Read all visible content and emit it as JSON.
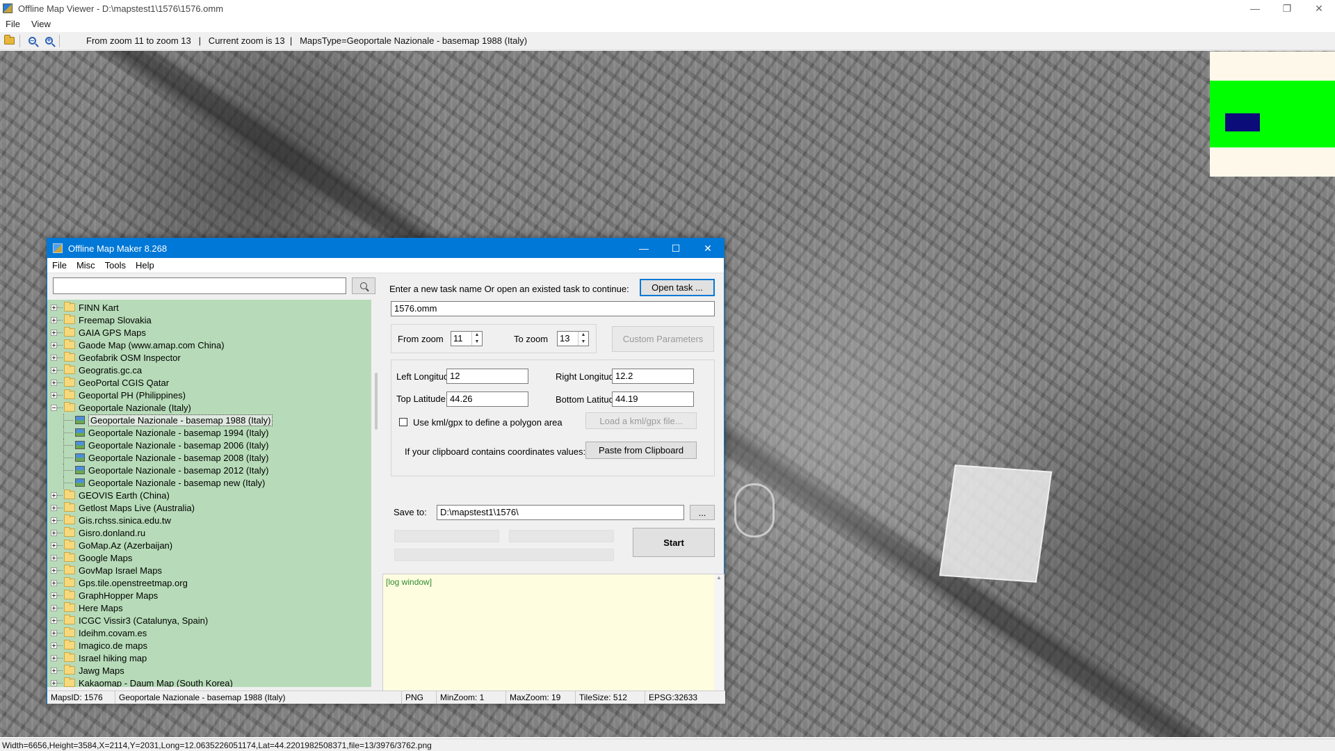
{
  "window": {
    "title": "Offline Map Viewer - D:\\mapstest1\\1576\\1576.omm",
    "controls": {
      "minimize": "—",
      "restore": "❐",
      "close": "✕"
    }
  },
  "menu": {
    "file": "File",
    "view": "View"
  },
  "toolbar": {
    "icons": [
      "open-folder-icon",
      "zoom-out-icon",
      "zoom-in-icon"
    ],
    "status": "From zoom 11 to zoom 13   |   Current zoom is 13  |   MapsType=Geoportale Nazionale - basemap 1988 (Italy)"
  },
  "colors": {
    "accent": "#0078d7",
    "tree_bg": "#b7dbb8",
    "minimap_bg": "#fdf8ea",
    "minimap_area": "#00ff00",
    "minimap_view": "#0b0b7a",
    "log_bg": "#fffde0",
    "log_text": "#2e8b2e"
  },
  "status_bar": "Width=6656,Height=3584,X=2114,Y=2031,Long=12.0635226051174,Lat=44.2201982508371,file=13/3976/3762.png",
  "dialog": {
    "title": "Offline Map Maker 8.268",
    "controls": {
      "minimize": "—",
      "maximize": "☐",
      "close": "✕"
    },
    "menu": [
      "File",
      "Misc",
      "Tools",
      "Help"
    ],
    "search": {
      "value": "",
      "placeholder": ""
    },
    "tree": {
      "items": [
        {
          "label": "FINN Kart",
          "type": "folder"
        },
        {
          "label": "Freemap Slovakia",
          "type": "folder"
        },
        {
          "label": "GAIA GPS Maps",
          "type": "folder"
        },
        {
          "label": "Gaode Map (www.amap.com China)",
          "type": "folder"
        },
        {
          "label": "Geofabrik OSM Inspector",
          "type": "folder"
        },
        {
          "label": "Geogratis.gc.ca",
          "type": "folder"
        },
        {
          "label": "GeoPortal CGIS Qatar",
          "type": "folder"
        },
        {
          "label": "Geoportal PH (Philippines)",
          "type": "folder"
        },
        {
          "label": "Geoportale Nazionale (Italy)",
          "type": "folder",
          "expanded": true
        },
        {
          "label": "Geoportale Nazionale - basemap 1988 (Italy)",
          "type": "map",
          "selected": true
        },
        {
          "label": "Geoportale Nazionale - basemap 1994 (Italy)",
          "type": "map"
        },
        {
          "label": "Geoportale Nazionale - basemap 2006 (Italy)",
          "type": "map"
        },
        {
          "label": "Geoportale Nazionale - basemap 2008 (Italy)",
          "type": "map"
        },
        {
          "label": "Geoportale Nazionale - basemap 2012 (Italy)",
          "type": "map"
        },
        {
          "label": "Geoportale Nazionale - basemap new (Italy)",
          "type": "map"
        },
        {
          "label": "GEOVIS Earth (China)",
          "type": "folder"
        },
        {
          "label": "Getlost Maps Live (Australia)",
          "type": "folder"
        },
        {
          "label": "Gis.rchss.sinica.edu.tw",
          "type": "folder"
        },
        {
          "label": "Gisro.donland.ru",
          "type": "folder"
        },
        {
          "label": "GoMap.Az (Azerbaijan)",
          "type": "folder"
        },
        {
          "label": "Google Maps",
          "type": "folder"
        },
        {
          "label": "GovMap Israel Maps",
          "type": "folder"
        },
        {
          "label": "Gps.tile.openstreetmap.org",
          "type": "folder"
        },
        {
          "label": "GraphHopper Maps",
          "type": "folder"
        },
        {
          "label": "Here Maps",
          "type": "folder"
        },
        {
          "label": "ICGC Vissir3 (Catalunya, Spain)",
          "type": "folder"
        },
        {
          "label": "Ideihm.covam.es",
          "type": "folder"
        },
        {
          "label": "Imagico.de maps",
          "type": "folder"
        },
        {
          "label": "Israel hiking map",
          "type": "folder"
        },
        {
          "label": "Jawg Maps",
          "type": "folder"
        },
        {
          "label": "Kakaomap - Daum Map (South Korea)",
          "type": "folder"
        }
      ]
    },
    "task": {
      "prompt": "Enter a new task name Or open an existed task to continue:",
      "open_label": "Open task ...",
      "name_value": "1576.omm"
    },
    "zoom": {
      "from_label": "From zoom",
      "from_value": "11",
      "to_label": "To zoom",
      "to_value": "13",
      "custom_label": "Custom Parameters"
    },
    "coords": {
      "left_lon_label": "Left Longitude",
      "left_lon_value": "12",
      "right_lon_label": "Right Longitude",
      "right_lon_value": "12.2",
      "top_lat_label": "Top Latitude",
      "top_lat_value": "44.26",
      "bottom_lat_label": "Bottom Latitude",
      "bottom_lat_value": "44.19",
      "kml_label": "Use kml/gpx to define a polygon area",
      "kml_checked": false,
      "load_kml_label": "Load a kml/gpx file...",
      "clipboard_prompt": "If your clipboard contains coordinates values:",
      "paste_label": "Paste from Clipboard"
    },
    "save": {
      "label": "Save to:",
      "value": "D:\\mapstest1\\1576\\",
      "browse_label": "...",
      "start_label": "Start"
    },
    "log": {
      "text": "[log window]"
    },
    "status": {
      "maps_id": "MapsID: 1576",
      "map_name": "Geoportale Nazionale - basemap 1988 (Italy)",
      "format": "PNG",
      "min_zoom": "MinZoom: 1",
      "max_zoom": "MaxZoom: 19",
      "tile_size": "TileSize: 512",
      "epsg": "EPSG:32633"
    }
  }
}
